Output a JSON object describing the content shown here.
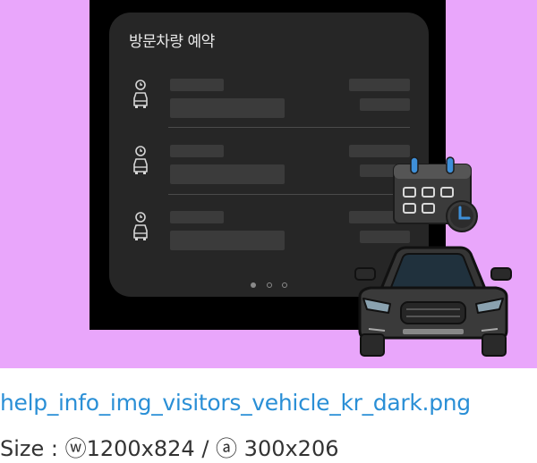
{
  "card": {
    "title": "방문차량 예약",
    "rows": [
      {
        "icon": "car-clock-icon"
      },
      {
        "icon": "car-clock-icon"
      },
      {
        "icon": "car-clock-icon"
      }
    ],
    "pagination": {
      "total": 3,
      "active": 0
    }
  },
  "illustration": {
    "calendar_icon": "calendar-clock-icon",
    "car_icon": "car-front-icon"
  },
  "caption": {
    "filename": "help_info_img_visitors_vehicle_kr_dark.png",
    "size_text": "Size : ⓦ1200x824 / ⓐ 300x206"
  }
}
